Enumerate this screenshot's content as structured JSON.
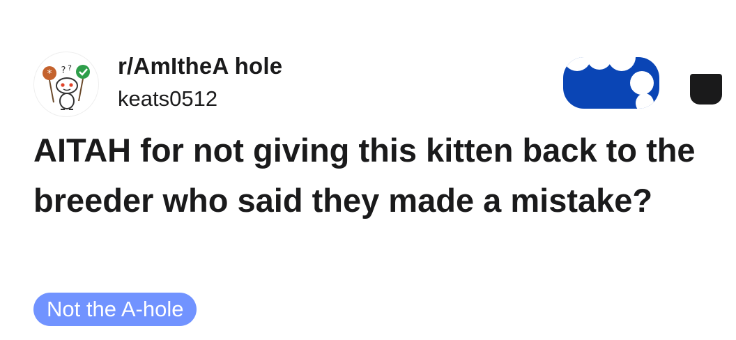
{
  "post": {
    "subreddit": "r/AmItheA  hole",
    "username": "keats0512",
    "title": "AITAH for not giving this kitten back to the breeder who said they made a mistake?",
    "flair": "Not the A-hole"
  },
  "icons": {
    "avatar": "snoo-avatar-icon",
    "join": "join-button",
    "more": "more-options-icon"
  },
  "colors": {
    "text": "#1a1a1b",
    "join_button": "#0a45b5",
    "flair_background": "#7193ff",
    "flair_text": "#ffffff"
  }
}
